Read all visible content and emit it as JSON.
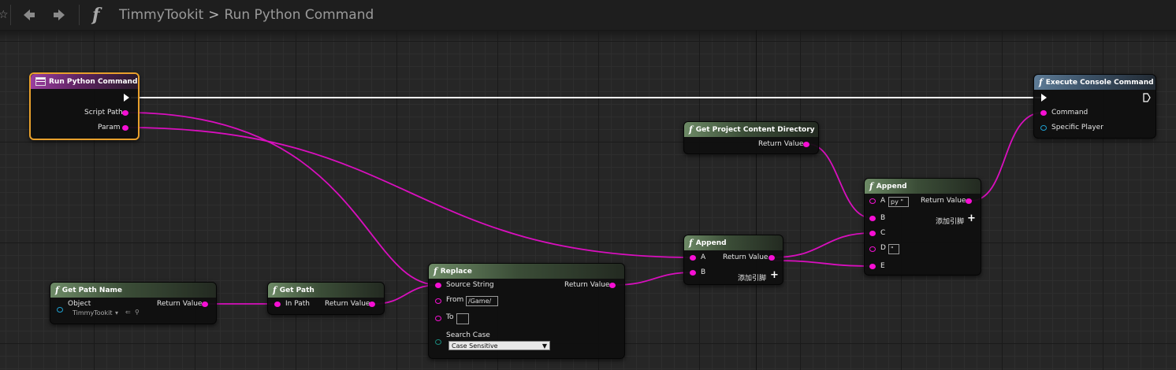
{
  "toolbar": {
    "breadcrumb_root": "TimmyTookit",
    "breadcrumb_sep": ">",
    "breadcrumb_current": "Run Python Command"
  },
  "nodes": {
    "run_python": {
      "title": "Run Python Command",
      "pin_script_path": "Script Path",
      "pin_param": "Param"
    },
    "execute_console": {
      "title": "Execute Console Command",
      "pin_command": "Command",
      "pin_specific_player": "Specific Player"
    },
    "get_content_dir": {
      "title": "Get Project Content Directory",
      "pin_return": "Return Value"
    },
    "append2": {
      "title": "Append",
      "pin_a": "A",
      "pin_a_value": "py \"",
      "pin_b": "B",
      "pin_c": "C",
      "pin_d": "D",
      "pin_d_value": "\"",
      "pin_e": "E",
      "pin_return": "Return Value",
      "add_pin": "添加引脚"
    },
    "append1": {
      "title": "Append",
      "pin_a": "A",
      "pin_b": "B",
      "pin_return": "Return Value",
      "add_pin": "添加引脚"
    },
    "replace": {
      "title": "Replace",
      "pin_source": "Source String",
      "pin_from": "From",
      "pin_from_value": "/Game/",
      "pin_to": "To",
      "pin_to_value": "",
      "pin_search_case": "Search Case",
      "search_case_value": "Case Sensitive",
      "pin_return": "Return Value"
    },
    "get_path": {
      "title": "Get Path",
      "pin_in": "In Path",
      "pin_return": "Return Value"
    },
    "get_path_name": {
      "title": "Get Path Name",
      "pin_object": "Object",
      "object_value": "TimmyTookit",
      "pin_return": "Return Value"
    }
  },
  "colors": {
    "string_pin": "#f60fd4",
    "object_pin": "#1fa2d3",
    "enum_pin": "#1a8a7d",
    "exec_wire": "#ffffff",
    "selection": "#e8a02c"
  },
  "icons": [
    "star-icon",
    "back-arrow-icon",
    "forward-arrow-icon",
    "function-icon"
  ]
}
